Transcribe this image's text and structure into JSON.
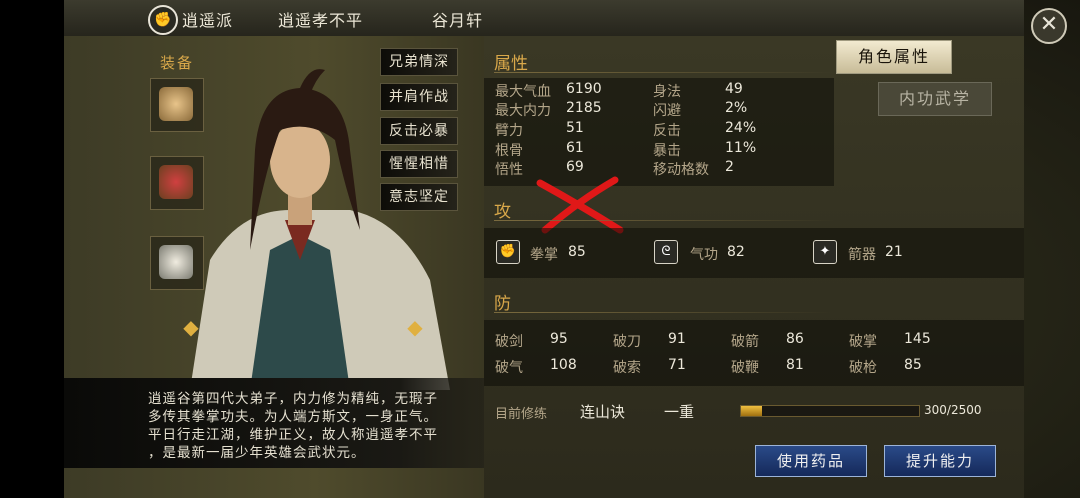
{
  "header": {
    "sect_icon": "fist-emblem-icon",
    "sect": "逍遥派",
    "name": "逍遥孝不平",
    "location": "谷月轩"
  },
  "equipment": {
    "label": "装备",
    "slots": [
      {
        "icon": "gloves-icon"
      },
      {
        "icon": "armor-icon"
      },
      {
        "icon": "accessory-icon"
      }
    ]
  },
  "traits": [
    "兄弟情深",
    "并肩作战",
    "反击必暴",
    "惺惺相惜",
    "意志坚定"
  ],
  "description": [
    "逍遥谷第四代大弟子，内力修为精纯，无瑕子",
    "多传其拳掌功夫。为人端方斯文，一身正气。",
    "平日行走江湖，维护正义，故人称逍遥孝不平",
    "，是最新一届少年英雄会武状元。"
  ],
  "tabs": {
    "active": "角色属性",
    "inactive": "内功武学"
  },
  "attributes": {
    "title": "属性",
    "left": [
      {
        "label": "最大气血",
        "value": "6190"
      },
      {
        "label": "最大内力",
        "value": "2185"
      },
      {
        "label": "臂力",
        "value": "51"
      },
      {
        "label": "根骨",
        "value": "61"
      },
      {
        "label": "悟性",
        "value": "69"
      }
    ],
    "right": [
      {
        "label": "身法",
        "value": "49"
      },
      {
        "label": "闪避",
        "value": "2%"
      },
      {
        "label": "反击",
        "value": "24%"
      },
      {
        "label": "暴击",
        "value": "11%"
      },
      {
        "label": "移动格数",
        "value": "2"
      }
    ]
  },
  "attack": {
    "title": "攻",
    "items": [
      {
        "icon": "fist-icon",
        "label": "拳掌",
        "value": "85"
      },
      {
        "icon": "qi-swirl-icon",
        "label": "气功",
        "value": "82"
      },
      {
        "icon": "dart-icon",
        "label": "箭器",
        "value": "21"
      }
    ]
  },
  "defense": {
    "title": "防",
    "row1": [
      {
        "label": "破剑",
        "value": "95"
      },
      {
        "label": "破刀",
        "value": "91"
      },
      {
        "label": "破箭",
        "value": "86"
      },
      {
        "label": "破掌",
        "value": "145"
      }
    ],
    "row2": [
      {
        "label": "破气",
        "value": "108"
      },
      {
        "label": "破索",
        "value": "71"
      },
      {
        "label": "破鞭",
        "value": "81"
      },
      {
        "label": "破枪",
        "value": "85"
      }
    ]
  },
  "cultivation": {
    "label": "目前修练",
    "skill": "连山诀",
    "level": "一重",
    "progress_text": "300/2500",
    "progress_fraction": 0.12
  },
  "buttons": {
    "use_medicine": "使用药品",
    "upgrade": "提升能力"
  },
  "colors": {
    "accent_gold": "#d9a84a",
    "button_blue": "#2a4a88",
    "annotation_red": "#e01818"
  }
}
